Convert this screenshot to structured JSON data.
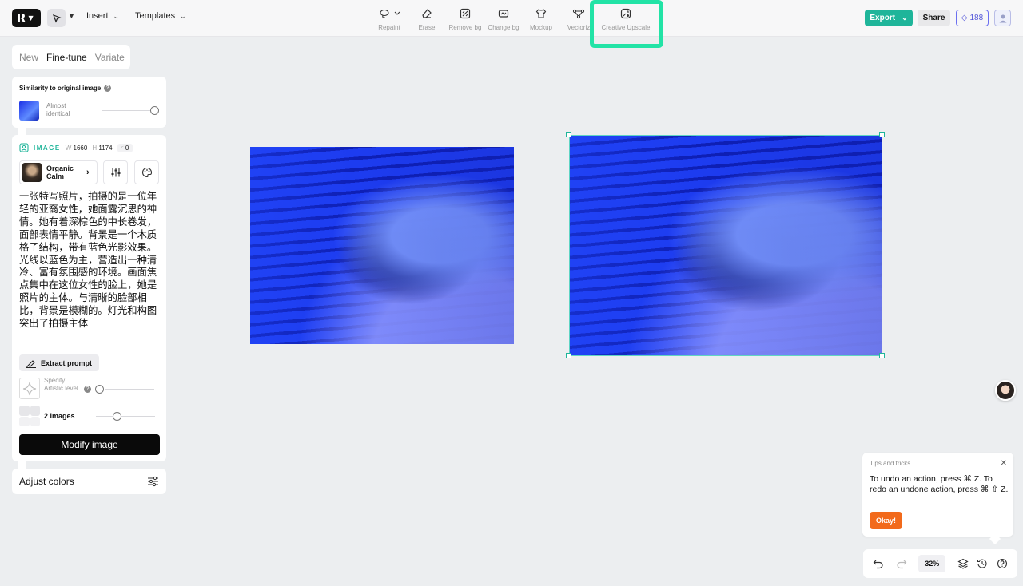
{
  "topbar": {
    "insert_label": "Insert",
    "templates_label": "Templates",
    "tools": [
      {
        "label": "Repaint"
      },
      {
        "label": "Erase"
      },
      {
        "label": "Remove bg"
      },
      {
        "label": "Change bg"
      },
      {
        "label": "Mockup"
      },
      {
        "label": "Vectoriz"
      },
      {
        "label": "Creative Upscale"
      }
    ],
    "export_label": "Export",
    "share_label": "Share",
    "credits": "188",
    "accent_color": "#1fb59a",
    "highlight_color": "#22e3a6"
  },
  "panel": {
    "tabs": [
      {
        "label": "New"
      },
      {
        "label": "Fine-tune"
      },
      {
        "label": "Variate"
      }
    ],
    "similarity": {
      "title": "Similarity to original image",
      "level_label": "Almost identical"
    },
    "image": {
      "label": "IMAGE",
      "w_label": "W",
      "w_value": "1660",
      "h_label": "H",
      "h_value": "1174",
      "seed": "0"
    },
    "style": {
      "name": "Organic Calm"
    },
    "prompt": "一张特写照片，拍摄的是一位年轻的亚裔女性，她面露沉思的神情。她有着深棕色的中长卷发，面部表情平静。背景是一个木质格子结构，带有蓝色光影效果。光线以蓝色为主，营造出一种清冷、富有氛围感的环境。画面焦点集中在这位女性的脸上，她是照片的主体。与清晰的脸部相比，背景是模糊的。灯光和构图突出了拍摄主体",
    "extract_label": "Extract prompt",
    "artistic_label": "Specify Artistic level",
    "images_label": "2 images",
    "modify_label": "Modify image",
    "adjust_label": "Adjust colors"
  },
  "tips": {
    "title": "Tips and tricks",
    "body": "To undo an action, press ⌘ Z. To redo an undone action, press ⌘ ⇧ Z.",
    "okay_label": "Okay!",
    "okay_color": "#f26a1b"
  },
  "bottom": {
    "zoom": "32%"
  }
}
